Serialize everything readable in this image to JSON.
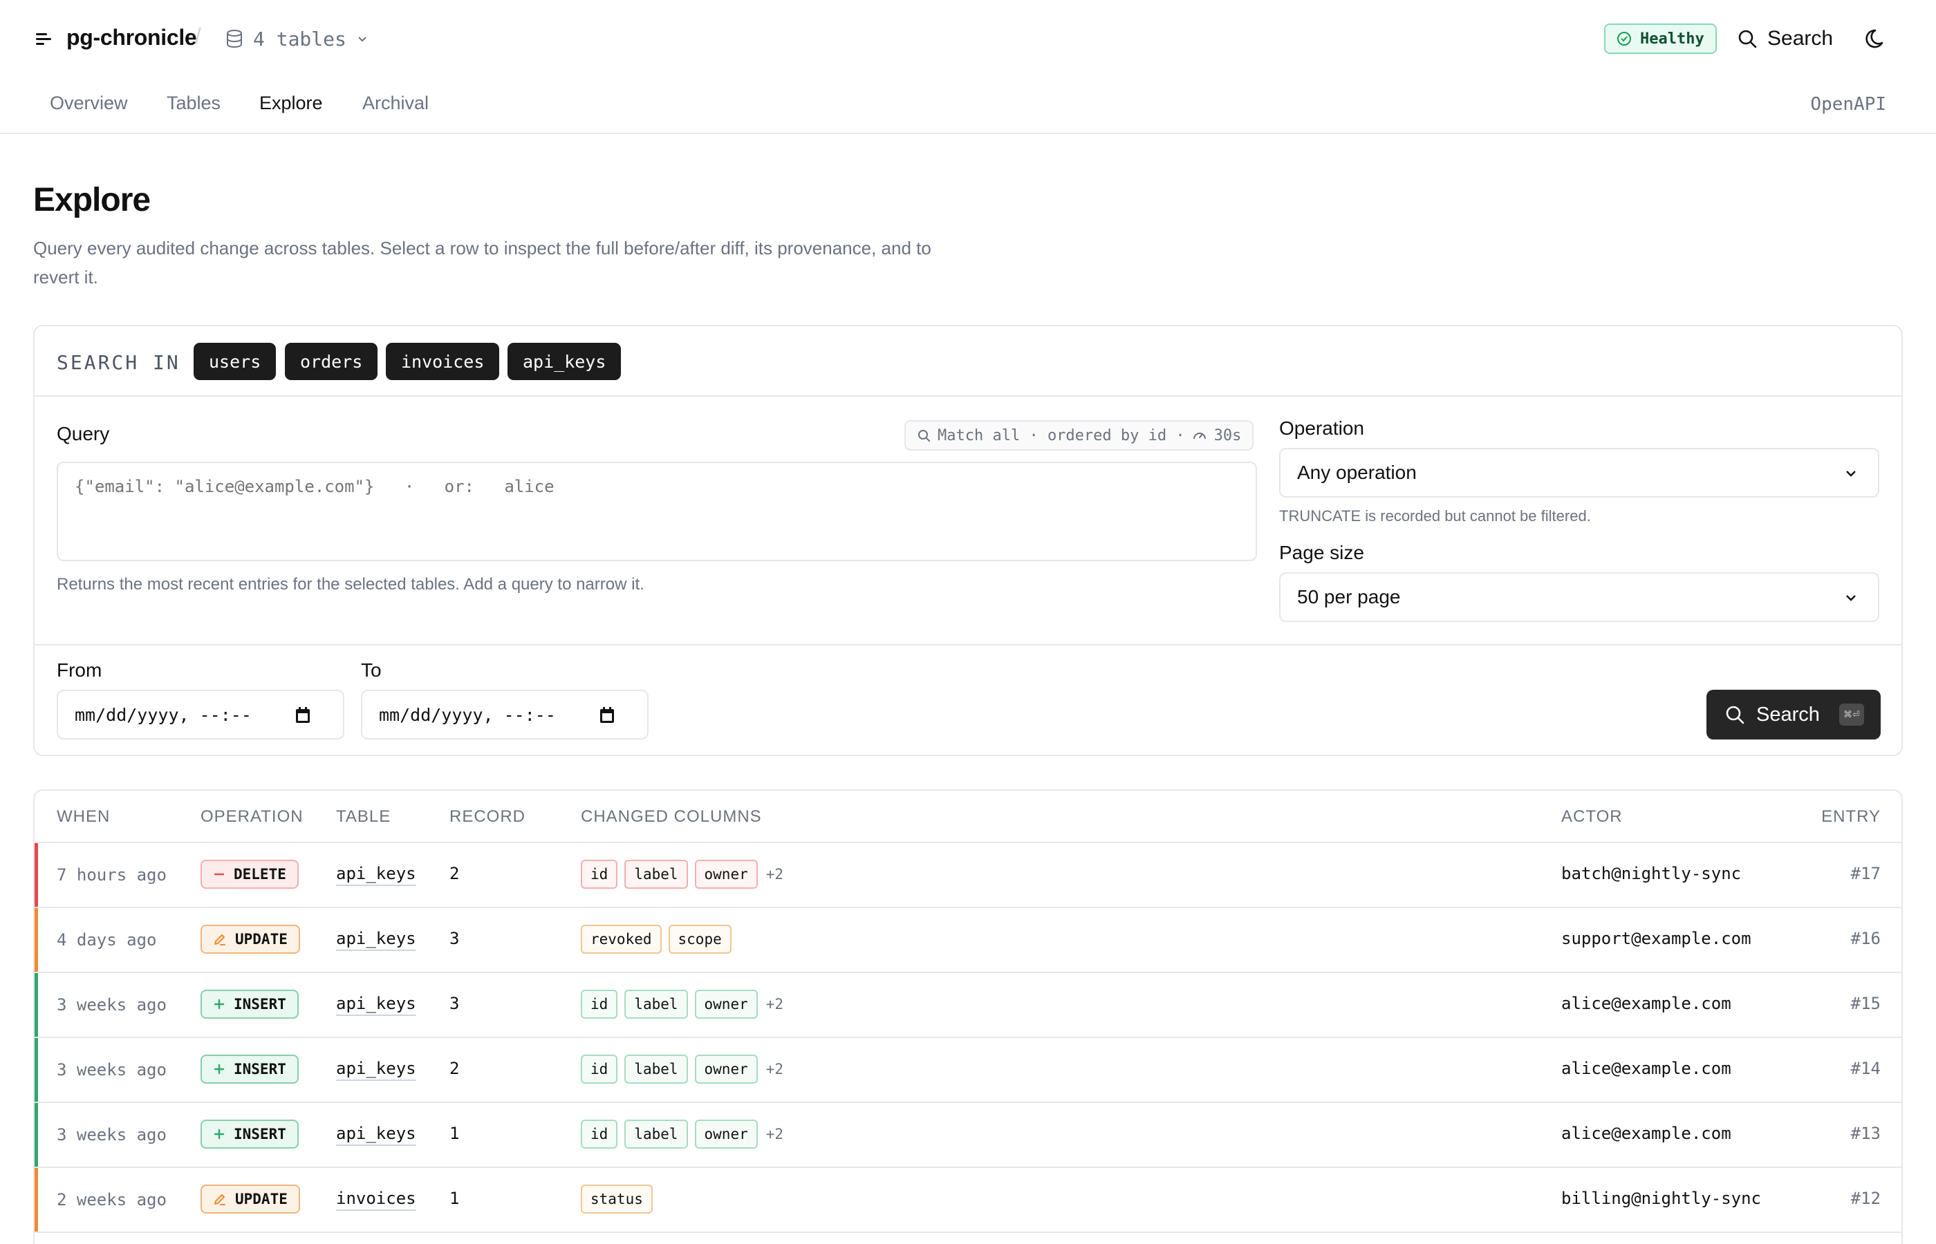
{
  "app": {
    "name": "pg-chronicle",
    "tables_count": "4 tables",
    "health": "Healthy",
    "search_label": "Search"
  },
  "nav": {
    "tabs": [
      {
        "label": "Overview"
      },
      {
        "label": "Tables"
      },
      {
        "label": "Explore",
        "active": true
      },
      {
        "label": "Archival"
      }
    ],
    "openapi": "OpenAPI"
  },
  "page": {
    "title": "Explore",
    "description": "Query every audited change across tables. Select a row to inspect the full before/after diff, its provenance, and to revert it."
  },
  "filters": {
    "search_in_label": "SEARCH IN",
    "tables": [
      "users",
      "orders",
      "invoices",
      "api_keys"
    ],
    "query_label": "Query",
    "query_hint": "Match all · ordered by id ·",
    "query_timeout": "30s",
    "query_placeholder": "{\"email\": \"alice@example.com\"}   ·   or:   alice",
    "query_help": "Returns the most recent entries for the selected tables. Add a query to narrow it.",
    "operation_label": "Operation",
    "operation_value": "Any operation",
    "operation_help": "TRUNCATE is recorded but cannot be filtered.",
    "page_size_label": "Page size",
    "page_size_value": "50 per page",
    "from_label": "From",
    "to_label": "To",
    "date_placeholder": "mm/dd/yyyy, --:--",
    "search_button": "Search",
    "search_shortcut": "⌘⏎"
  },
  "results": {
    "headers": {
      "when": "WHEN",
      "operation": "OPERATION",
      "table": "TABLE",
      "record": "RECORD",
      "changed_columns": "CHANGED COLUMNS",
      "actor": "ACTOR",
      "entry": "ENTRY"
    },
    "rows": [
      {
        "when": "7 hours ago",
        "op": "DELETE",
        "table": "api_keys",
        "record": "2",
        "columns": [
          "id",
          "label",
          "owner"
        ],
        "more": "+2",
        "actor": "batch@nightly-sync",
        "entry": "#17"
      },
      {
        "when": "4 days ago",
        "op": "UPDATE",
        "table": "api_keys",
        "record": "3",
        "columns": [
          "revoked",
          "scope"
        ],
        "more": "",
        "actor": "support@example.com",
        "entry": "#16"
      },
      {
        "when": "3 weeks ago",
        "op": "INSERT",
        "table": "api_keys",
        "record": "3",
        "columns": [
          "id",
          "label",
          "owner"
        ],
        "more": "+2",
        "actor": "alice@example.com",
        "entry": "#15"
      },
      {
        "when": "3 weeks ago",
        "op": "INSERT",
        "table": "api_keys",
        "record": "2",
        "columns": [
          "id",
          "label",
          "owner"
        ],
        "more": "+2",
        "actor": "alice@example.com",
        "entry": "#14"
      },
      {
        "when": "3 weeks ago",
        "op": "INSERT",
        "table": "api_keys",
        "record": "1",
        "columns": [
          "id",
          "label",
          "owner"
        ],
        "more": "+2",
        "actor": "alice@example.com",
        "entry": "#13"
      },
      {
        "when": "2 weeks ago",
        "op": "UPDATE",
        "table": "invoices",
        "record": "1",
        "columns": [
          "status"
        ],
        "more": "",
        "actor": "billing@nightly-sync",
        "entry": "#12"
      }
    ]
  },
  "colors": {
    "delete": "#e5484d",
    "update": "#f08c2e",
    "insert": "#2fa86e",
    "healthy": "#12a150"
  }
}
